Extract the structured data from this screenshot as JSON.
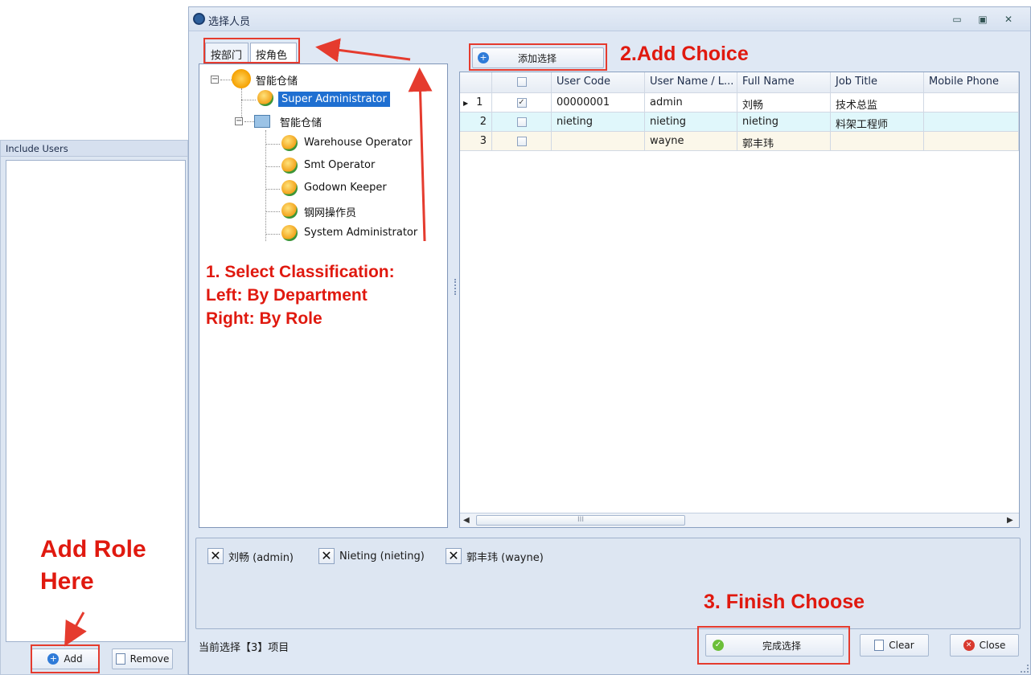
{
  "left_panel": {
    "header": "Include Users",
    "add_label": "Add",
    "remove_label": "Remove"
  },
  "dialog": {
    "title": "选择人员",
    "tabs": [
      "按部门",
      "按角色"
    ],
    "add_choice_label": "添加选择",
    "tree": {
      "root": "智能仓储",
      "root_child": "Super Administrator",
      "dept": "智能仓储",
      "roles": [
        "Warehouse Operator",
        "Smt Operator",
        "Godown Keeper",
        "钢网操作员",
        "System Administrator"
      ]
    },
    "grid": {
      "columns": [
        "",
        "",
        "User Code",
        "User Name / L...",
        "Full Name",
        "Job Title",
        "Mobile Phone"
      ],
      "rows": [
        {
          "num": "1",
          "checked": true,
          "code": "00000001",
          "username": "admin",
          "fullname": "刘畅",
          "job": "技术总监",
          "mobile": ""
        },
        {
          "num": "2",
          "checked": false,
          "code": "nieting",
          "username": "nieting",
          "fullname": "nieting",
          "job": "料架工程师",
          "mobile": ""
        },
        {
          "num": "3",
          "checked": false,
          "code": "",
          "username": "wayne",
          "fullname": "郭丰玮",
          "job": "",
          "mobile": ""
        }
      ],
      "hscroll_grip": "III"
    },
    "selected_chips": [
      "刘畅 (admin)",
      "Nieting (nieting)",
      "郭丰玮 (wayne)"
    ],
    "status_text": "当前选择【3】项目",
    "finish_label": "完成选择",
    "clear_label": "Clear",
    "close_label": "Close"
  },
  "annotations": {
    "add_choice": "2.Add Choice",
    "select_classification": [
      "1. Select Classification:",
      "Left: By Department",
      "Right: By Role"
    ],
    "add_role": [
      "Add Role",
      "Here"
    ],
    "finish_choose": "3. Finish Choose"
  },
  "colors": {
    "annotation_red": "#e0190f",
    "selection_blue": "#1f6fd1",
    "row2_bg": "#e0f7fb",
    "row3_bg": "#fbf7ea"
  }
}
